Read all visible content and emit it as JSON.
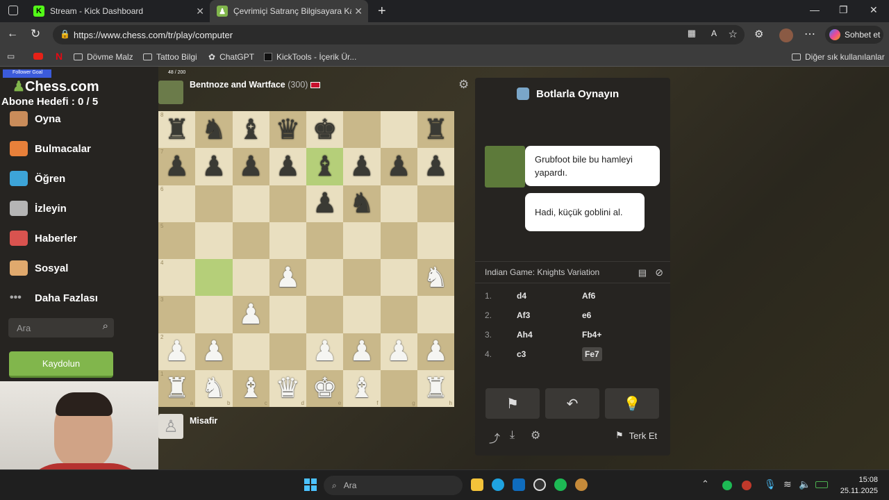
{
  "tabs": [
    {
      "title": "Stream - Kick Dashboard",
      "favicon": "K"
    },
    {
      "title": "Çevrimiçi Satranç Bilgisayara Kar",
      "favicon": "pawn-icon"
    }
  ],
  "address": {
    "url": "https://www.chess.com/tr/play/computer"
  },
  "profile": {
    "copilot_label": "Sohbet et"
  },
  "bookmarks": [
    "Dövme Malz",
    "Tattoo Bilgi",
    "ChatGPT",
    "KickTools - İçerik Ür..."
  ],
  "bookmarks_other": "Diğer sık kullanılanlar",
  "overlay": {
    "follower_goal": "Follower Goal",
    "goal_count": "48 / 200",
    "sub_goal": "Abone Hedefi : 0 / 5"
  },
  "sidebar": {
    "logo": "Chess.com",
    "items": [
      {
        "label": "Oyna",
        "icon": "pawn-icon"
      },
      {
        "label": "Bulmacalar",
        "icon": "puzzle-icon"
      },
      {
        "label": "Öğren",
        "icon": "learn-icon"
      },
      {
        "label": "İzleyin",
        "icon": "binoculars-icon"
      },
      {
        "label": "Haberler",
        "icon": "news-icon"
      },
      {
        "label": "Sosyal",
        "icon": "social-icon"
      },
      {
        "label": "Daha Fazlası",
        "icon": "more-icon"
      }
    ],
    "search_placeholder": "Ara",
    "signup": "Kaydolun"
  },
  "opponent": {
    "name": "Bentnoze and Wartface",
    "rating": "(300)"
  },
  "player": {
    "name": "Misafir"
  },
  "board": {
    "ranks": [
      "8",
      "7",
      "6",
      "5",
      "4",
      "3",
      "2",
      "1"
    ],
    "files": [
      "a",
      "b",
      "c",
      "d",
      "e",
      "f",
      "g",
      "h"
    ],
    "rows": [
      [
        "br",
        "bn",
        "bb",
        "bq",
        "bk",
        "",
        "",
        "br"
      ],
      [
        "bp",
        "bp",
        "bp",
        "bp",
        "bb",
        "bp",
        "bp",
        "bp"
      ],
      [
        "",
        "",
        "",
        "",
        "bp",
        "bn",
        "",
        ""
      ],
      [
        "",
        "",
        "",
        "",
        "",
        "",
        "",
        ""
      ],
      [
        "",
        "",
        "",
        "wp",
        "",
        "",
        "",
        "wn"
      ],
      [
        "",
        "",
        "wp",
        "",
        "",
        "",
        "",
        ""
      ],
      [
        "wp",
        "wp",
        "",
        "",
        "wp",
        "wp",
        "wp",
        "wp"
      ],
      [
        "wr",
        "wn",
        "wb",
        "wq",
        "wk",
        "wb",
        "",
        "wr"
      ]
    ],
    "highlights": [
      "e7",
      "b4"
    ]
  },
  "panel": {
    "title": "Botlarla Oynayın",
    "messages": [
      "Grubfoot bile bu hamleyi yapardı.",
      "Hadi, küçük goblini al."
    ],
    "opening": "Indian Game: Knights Variation",
    "moves": [
      {
        "num": "1.",
        "white": "d4",
        "black": "Af6"
      },
      {
        "num": "2.",
        "white": "Af3",
        "black": "e6"
      },
      {
        "num": "3.",
        "white": "Ah4",
        "black": "Fb4+"
      },
      {
        "num": "4.",
        "white": "c3",
        "black": "Fe7"
      }
    ],
    "resign": "Terk Et"
  },
  "taskbar": {
    "search": "Ara",
    "time": "15:08",
    "date": "25.11.2025"
  },
  "colors": {
    "board_light": "#e9dfc0",
    "board_dark": "#c9b88a",
    "highlight": "#b5cf79",
    "accent": "#81b64c"
  }
}
